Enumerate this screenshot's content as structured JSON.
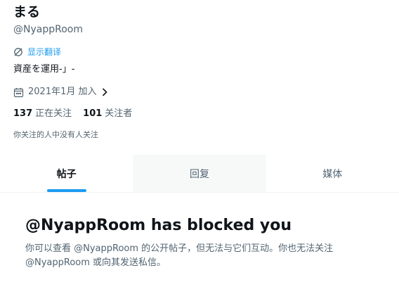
{
  "profile": {
    "display_name": "まる",
    "handle": "@NyappRoom",
    "translate_label": "显示翻译",
    "bio": "資産を運用-」-",
    "joined": "2021年1月 加入",
    "following_count": "137",
    "following_label": "正在关注",
    "followers_count": "101",
    "followers_label": "关注者",
    "followers_note": "你关注的人中没有人关注"
  },
  "tabs": [
    {
      "label": "帖子",
      "active": true
    },
    {
      "label": "回复",
      "active": false
    },
    {
      "label": "媒体",
      "active": false
    }
  ],
  "blocked": {
    "title": "@NyappRoom has blocked you",
    "description": "你可以查看 @NyappRoom 的公开帖子，但无法与它们互动。你也无法关注 @NyappRoom 或向其发送私信。"
  },
  "colors": {
    "accent": "#1d9bf0",
    "text_primary": "#0f1419",
    "text_secondary": "#536471"
  },
  "icons": {
    "translate": "translate-icon",
    "calendar": "calendar-icon",
    "chevron": "chevron-right-icon"
  }
}
